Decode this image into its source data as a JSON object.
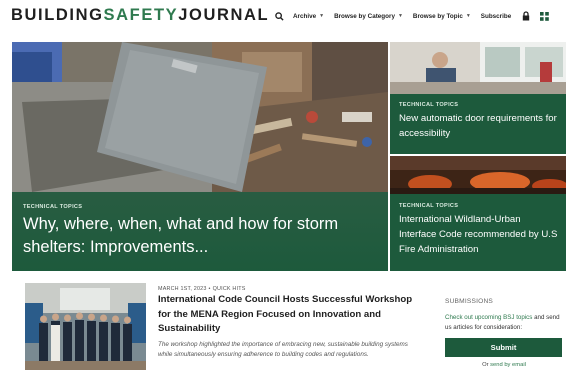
{
  "site": {
    "logo_part1": "BUILDING",
    "logo_part2": "SAFETY",
    "logo_part3": "JOURNAL"
  },
  "nav": {
    "items": [
      {
        "label": "Archive"
      },
      {
        "label": "Browse by Category"
      },
      {
        "label": "Browse by Topic"
      }
    ],
    "subscribe": "Subscribe",
    "caret": "▼"
  },
  "hero": {
    "category": "TECHNICAL TOPICS",
    "title": "Why, where, when, what and how for storm shelters: Improvements..."
  },
  "side_stories": [
    {
      "category": "TECHNICAL TOPICS",
      "title": "New automatic door requirements for accessibility"
    },
    {
      "category": "TECHNICAL TOPICS",
      "title": "International Wildland-Urban Interface Code recommended by U.S Fire Administration"
    }
  ],
  "article": {
    "date": "MARCH 1ST, 2023",
    "separator": "•",
    "category": "QUICK HITS",
    "title": "International Code Council Hosts Successful Workshop for the MENA Region Focused on Innovation and Sustainability",
    "excerpt": "The workshop highlighted the importance of embracing new, sustainable building systems while simultaneously ensuring adherence to building codes and regulations."
  },
  "submissions": {
    "heading": "SUBMISSIONS",
    "text_link": "Check out upcoming BSJ topics",
    "text_rest": " and send us articles for consideration:",
    "button": "Submit",
    "or_prefix": "Or ",
    "or_link": "send by email"
  },
  "colors": {
    "brand_green": "#1d5a3c",
    "accent_green": "#2f7a4f"
  },
  "icons": {
    "search": "search-icon",
    "lock": "lock-icon",
    "menu": "grid-menu-icon"
  }
}
